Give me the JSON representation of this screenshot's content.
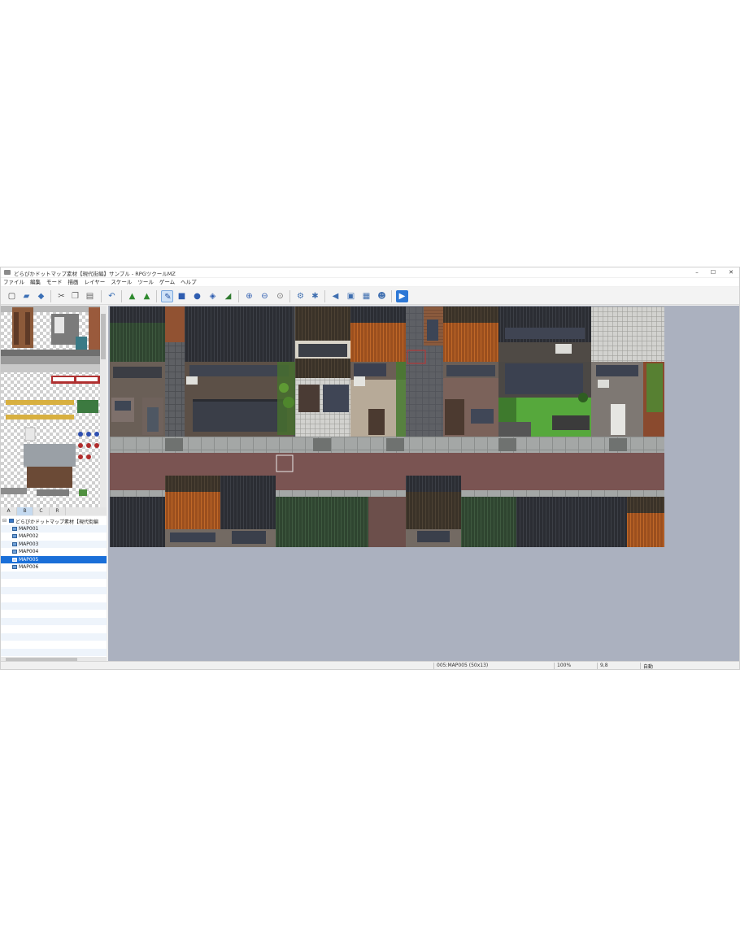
{
  "window": {
    "title": "どらぴかドットマップ素材【現代街編】サンプル - RPGツクールMZ",
    "controls": {
      "minimize": "–",
      "maximize": "☐",
      "close": "✕"
    }
  },
  "menu": [
    "ファイル",
    "編集",
    "モード",
    "描画",
    "レイヤー",
    "スケール",
    "ツール",
    "ゲーム",
    "ヘルプ"
  ],
  "toolbar": [
    {
      "name": "new-project-icon",
      "glyph": "▢",
      "color": "#4a4a4a"
    },
    {
      "name": "open-project-icon",
      "glyph": "▰",
      "color": "#3b6fb5"
    },
    {
      "name": "save-project-icon",
      "glyph": "◆",
      "color": "#3b6fb5"
    },
    {
      "name": "cut-icon",
      "glyph": "✂",
      "color": "#555555"
    },
    {
      "name": "copy-icon",
      "glyph": "❐",
      "color": "#666666"
    },
    {
      "name": "paste-icon",
      "glyph": "▤",
      "color": "#666666"
    },
    {
      "name": "undo-icon",
      "glyph": "↶",
      "color": "#3b6fb5"
    },
    {
      "name": "map-mode-icon",
      "glyph": "▲",
      "color": "#2f8a2f"
    },
    {
      "name": "event-mode-icon",
      "glyph": "▲",
      "color": "#2f8a2f"
    },
    {
      "name": "pencil-icon",
      "glyph": "✎",
      "color": "#1f4fa0"
    },
    {
      "name": "rectangle-icon",
      "glyph": "■",
      "color": "#2e5db0"
    },
    {
      "name": "ellipse-icon",
      "glyph": "●",
      "color": "#2e5db0"
    },
    {
      "name": "fill-icon",
      "glyph": "◈",
      "color": "#2e5db0"
    },
    {
      "name": "shadow-pen-icon",
      "glyph": "◢",
      "color": "#2e7a2e"
    },
    {
      "name": "zoom-in-icon",
      "glyph": "⊕",
      "color": "#2e5db0"
    },
    {
      "name": "zoom-out-icon",
      "glyph": "⊖",
      "color": "#2e5db0"
    },
    {
      "name": "zoom-actual-icon",
      "glyph": "⊙",
      "color": "#6b6b6b"
    },
    {
      "name": "database-icon",
      "glyph": "⚙",
      "color": "#3f6fb0"
    },
    {
      "name": "plugin-manager-icon",
      "glyph": "✱",
      "color": "#3f6fb0"
    },
    {
      "name": "sound-test-icon",
      "glyph": "◀",
      "color": "#3f6fb0"
    },
    {
      "name": "event-searcher-icon",
      "glyph": "▣",
      "color": "#3f6fb0"
    },
    {
      "name": "resource-manager-icon",
      "glyph": "▦",
      "color": "#3f6fb0"
    },
    {
      "name": "character-generator-icon",
      "glyph": "☻",
      "color": "#3f6fb0"
    },
    {
      "name": "playtest-icon",
      "glyph": "▶",
      "color": "#ffffff",
      "bg": "#2d78d6"
    }
  ],
  "tileset_tabs": [
    "A",
    "B",
    "C",
    "R"
  ],
  "tileset_active_tab": "B",
  "map_tree": {
    "root": "どらぴかドットマップ素材【現代街編",
    "maps": [
      "MAP001",
      "MAP002",
      "MAP003",
      "MAP004",
      "MAP005",
      "MAP006"
    ],
    "selected": "MAP005"
  },
  "status": {
    "map": "005:MAP005 (50x13)",
    "zoom": "100%",
    "coords": "9,8",
    "mode": "自動"
  },
  "colors": {
    "selection": "#1a6fd8",
    "map_background": "#abb1bf",
    "road": "#7a5452",
    "sidewalk": "#9fa3a3"
  }
}
